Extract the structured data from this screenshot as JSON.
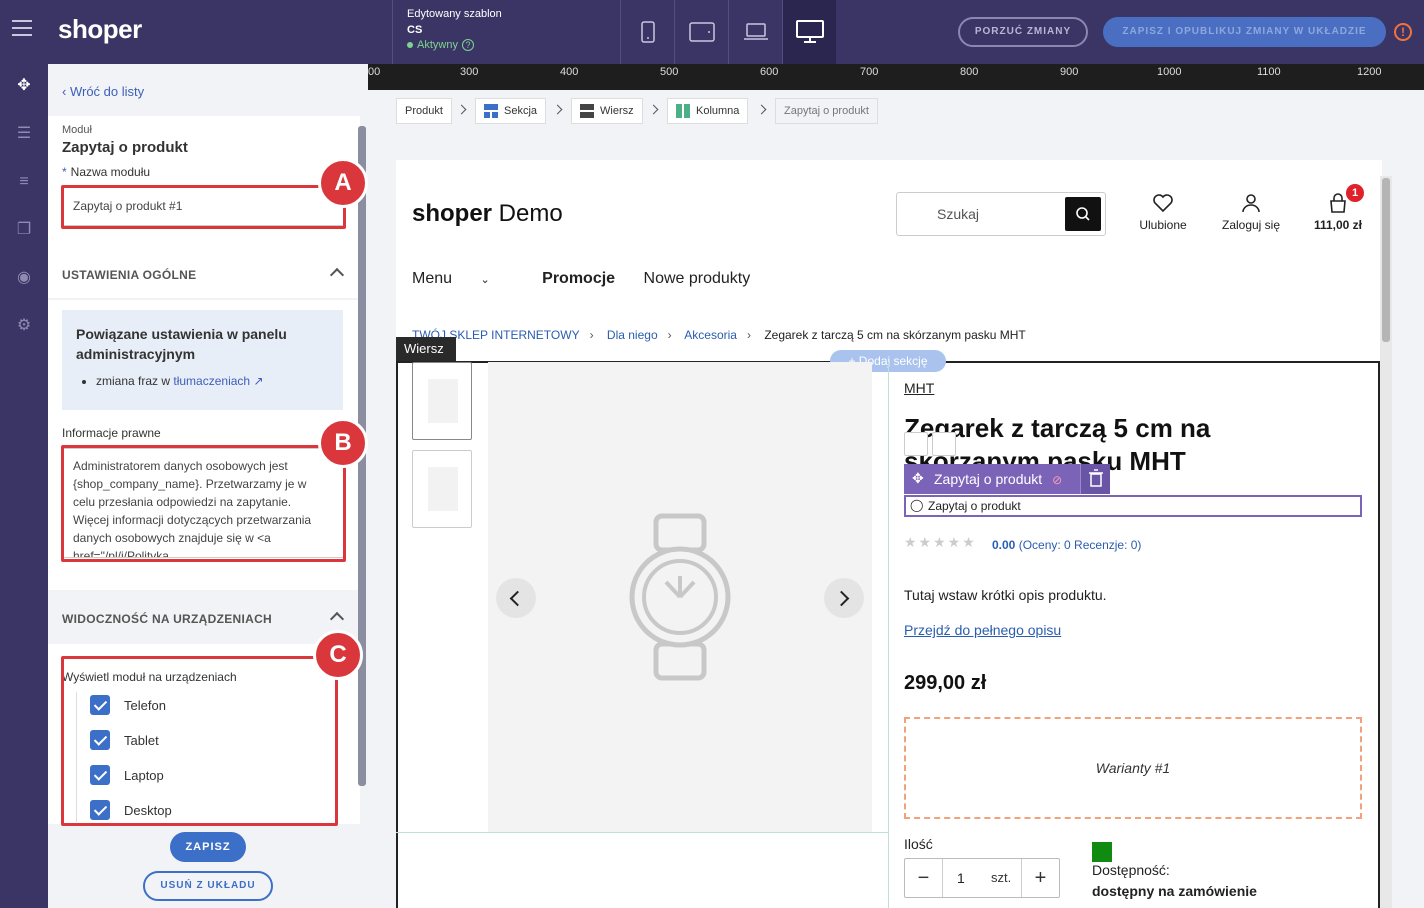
{
  "topbar": {
    "logo": "shoper",
    "template_label": "Edytowany szablon",
    "template_name": "CS",
    "status": "Aktywny",
    "help": "?",
    "discard_label": "PORZUĆ ZMIANY",
    "publish_label": "ZAPISZ I OPUBLIKUJ ZMIANY W UKŁADZIE",
    "warning": "!",
    "devices": [
      "phone-icon",
      "tablet-icon",
      "laptop-icon",
      "desktop-icon"
    ],
    "active_device": "desktop-icon"
  },
  "rail": {
    "icons": [
      "move-icon",
      "sections-icon",
      "rows-icon",
      "pages-icon",
      "palette-icon",
      "gear-icon"
    ]
  },
  "panel": {
    "back_label": "Wróć do listy",
    "module_label": "Moduł",
    "module_title": "Zapytaj o produkt",
    "name_label": "Nazwa modułu",
    "required_mark": "*",
    "name_value": "Zapytaj o produkt #1",
    "general_heading": "USTAWIENIA OGÓLNE",
    "info_title": "Powiązane ustawienia w panelu administracyjnym",
    "info_item_prefix": "zmiana fraz w",
    "info_item_link": "tłumaczeniach",
    "legal_label": "Informacje prawne",
    "legal_value": "Administratorem danych osobowych jest {shop_company_name}. Przetwarzamy je w celu przesłania odpowiedzi na zapytanie. Więcej informacji dotyczących przetwarzania danych osobowych znajduje się w <a href=\"/pl/i/Polityka",
    "visibility_heading": "WIDOCZNOŚĆ NA URZĄDZENIACH",
    "devices_label": "Wyświetl moduł na urządzeniach",
    "devices": [
      {
        "label": "Telefon",
        "checked": true
      },
      {
        "label": "Tablet",
        "checked": true
      },
      {
        "label": "Laptop",
        "checked": true
      },
      {
        "label": "Desktop",
        "checked": true
      }
    ],
    "save_label": "ZAPISZ",
    "remove_label": "USUŃ Z UKŁADU"
  },
  "annotations": [
    "A",
    "B",
    "C"
  ],
  "ruler": [
    "00",
    "300",
    "400",
    "500",
    "600",
    "700",
    "800",
    "900",
    "1000",
    "1100",
    "1200"
  ],
  "breadcrumb": [
    "Produkt",
    "Sekcja",
    "Wiersz",
    "Kolumna",
    "Zapytaj o produkt"
  ],
  "store": {
    "logo_bold": "shoper",
    "logo_rest": " Demo",
    "search_placeholder": "Szukaj",
    "favorites": "Ulubione",
    "login": "Zaloguj się",
    "cart_total": "111,00 zł",
    "cart_count": "1",
    "nav": [
      "Menu",
      "Promocje",
      "Nowe produkty"
    ],
    "crumbs": [
      "TWÓJ SKLEP INTERNETOWY",
      "Dla niego",
      "Akcesoria",
      "Zegarek z tarczą 5 cm na skórzanym pasku MHT"
    ],
    "row_label": "Wiersz",
    "add_section": "+ Dodaj sekcję",
    "brand": "MHT",
    "product_title": "Zegarek z tarczą 5 cm na skórzanym pasku MHT",
    "module_bar": "Zapytaj o produkt",
    "module_inline": "Zapytaj o produkt",
    "stars": "★★★★★",
    "rating_value": "0.00",
    "rating_text": "(Oceny: 0 Recenzje: 0)",
    "short_desc": "Tutaj wstaw krótki opis produktu.",
    "full_desc_link": "Przejdź do pełnego opisu",
    "price": "299,00 zł",
    "variants": "Warianty #1",
    "qty_label": "Ilość",
    "qty_value": "1",
    "qty_unit": "szt.",
    "qty_minus": "−",
    "qty_plus": "+",
    "availability_label": "Dostępność:",
    "availability_value": "dostępny na zamówienie",
    "colors": {
      "accent": "#3c6fc7",
      "status": "#118a11",
      "module": "#7b63b8",
      "annotation": "#d9373b"
    }
  }
}
